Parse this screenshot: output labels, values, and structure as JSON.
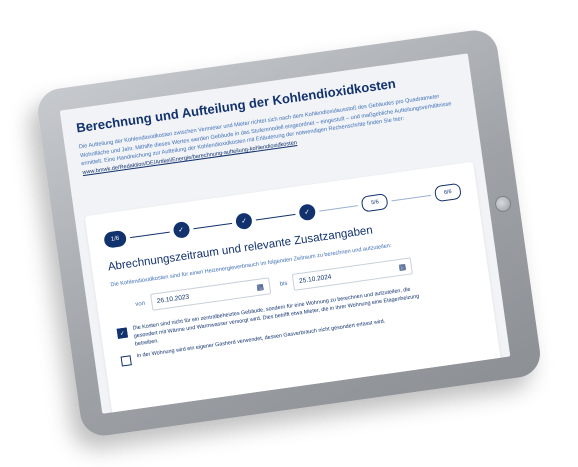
{
  "intro": {
    "title": "Berechnung und Aufteilung der Kohlendioxidkosten",
    "text": "Die Aufteilung der Kohlendioxidkosten zwischen Vermieter und Mieter richtet sich nach dem Kohlendioxidausstoß des Gebäudes pro Quadratmeter Wohnfläche und Jahr. Mithilfe dieses Wertes werden Gebäude in das Stufenmodell eingeordnet – eingestuft – und maßgebliche Aufteilungsverhältnisse ermittelt. Eine Handreichung zur Aufteilung der Kohlendioxidkosten mit Erläuterung der notwendigen Rechenschritte finden Sie hier:",
    "link": "www.bmwk.de/Redaktion/DE/Artikel/Energie/berechnung-aufteilung-kohlendioxidkosten"
  },
  "stepper": {
    "current": "1/6",
    "pending": [
      "5/6",
      "6/6"
    ]
  },
  "form": {
    "title": "Abrechnungszeitraum und relevante Zusatzangaben",
    "description": "Die Kohlendioxidkosten sind für einen Heizenergieverbrauch im folgenden Zeitraum zu berechnen und aufzuteilen:",
    "from_label": "von",
    "from_value": "26.10.2023",
    "to_label": "bis",
    "to_value": "25.10.2024",
    "checkboxes": [
      {
        "checked": true,
        "label": "Die Kosten sind nicht für ein zentralbeheiztes Gebäude, sondern für eine Wohnung zu berechnen und aufzuteilen, die gesondert mit Wärme und Warmwasser versorgt wird. Dies betrifft etwa Mieter, die in ihrer Wohnung eine Etagenheizung betreiben."
      },
      {
        "checked": false,
        "label": "In der Wohnung wird ein eigener Gasherd verwendet, dessen Gasverbrauch nicht gesondert erfasst wird."
      }
    ]
  },
  "icons": {
    "check": "check-icon",
    "calendar": "calendar-icon"
  },
  "colors": {
    "brand": "#12326e",
    "accent": "#3f6fb8"
  }
}
